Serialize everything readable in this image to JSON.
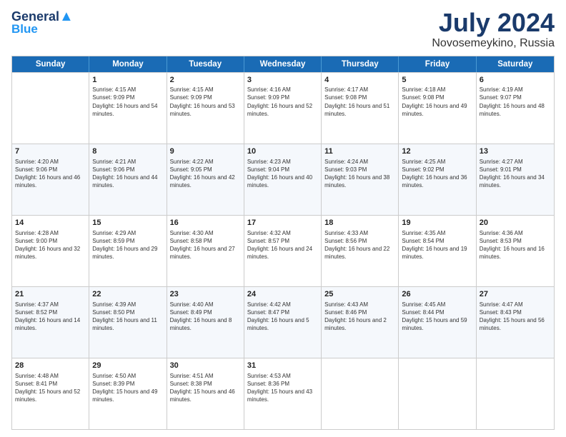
{
  "header": {
    "logo_line1": "General",
    "logo_line2": "Blue",
    "title": "July 2024",
    "subtitle": "Novosemeykino, Russia"
  },
  "days": [
    "Sunday",
    "Monday",
    "Tuesday",
    "Wednesday",
    "Thursday",
    "Friday",
    "Saturday"
  ],
  "weeks": [
    [
      {
        "day": "",
        "sunrise": "",
        "sunset": "",
        "daylight": ""
      },
      {
        "day": "1",
        "sunrise": "Sunrise: 4:15 AM",
        "sunset": "Sunset: 9:09 PM",
        "daylight": "Daylight: 16 hours and 54 minutes."
      },
      {
        "day": "2",
        "sunrise": "Sunrise: 4:15 AM",
        "sunset": "Sunset: 9:09 PM",
        "daylight": "Daylight: 16 hours and 53 minutes."
      },
      {
        "day": "3",
        "sunrise": "Sunrise: 4:16 AM",
        "sunset": "Sunset: 9:09 PM",
        "daylight": "Daylight: 16 hours and 52 minutes."
      },
      {
        "day": "4",
        "sunrise": "Sunrise: 4:17 AM",
        "sunset": "Sunset: 9:08 PM",
        "daylight": "Daylight: 16 hours and 51 minutes."
      },
      {
        "day": "5",
        "sunrise": "Sunrise: 4:18 AM",
        "sunset": "Sunset: 9:08 PM",
        "daylight": "Daylight: 16 hours and 49 minutes."
      },
      {
        "day": "6",
        "sunrise": "Sunrise: 4:19 AM",
        "sunset": "Sunset: 9:07 PM",
        "daylight": "Daylight: 16 hours and 48 minutes."
      }
    ],
    [
      {
        "day": "7",
        "sunrise": "Sunrise: 4:20 AM",
        "sunset": "Sunset: 9:06 PM",
        "daylight": "Daylight: 16 hours and 46 minutes."
      },
      {
        "day": "8",
        "sunrise": "Sunrise: 4:21 AM",
        "sunset": "Sunset: 9:06 PM",
        "daylight": "Daylight: 16 hours and 44 minutes."
      },
      {
        "day": "9",
        "sunrise": "Sunrise: 4:22 AM",
        "sunset": "Sunset: 9:05 PM",
        "daylight": "Daylight: 16 hours and 42 minutes."
      },
      {
        "day": "10",
        "sunrise": "Sunrise: 4:23 AM",
        "sunset": "Sunset: 9:04 PM",
        "daylight": "Daylight: 16 hours and 40 minutes."
      },
      {
        "day": "11",
        "sunrise": "Sunrise: 4:24 AM",
        "sunset": "Sunset: 9:03 PM",
        "daylight": "Daylight: 16 hours and 38 minutes."
      },
      {
        "day": "12",
        "sunrise": "Sunrise: 4:25 AM",
        "sunset": "Sunset: 9:02 PM",
        "daylight": "Daylight: 16 hours and 36 minutes."
      },
      {
        "day": "13",
        "sunrise": "Sunrise: 4:27 AM",
        "sunset": "Sunset: 9:01 PM",
        "daylight": "Daylight: 16 hours and 34 minutes."
      }
    ],
    [
      {
        "day": "14",
        "sunrise": "Sunrise: 4:28 AM",
        "sunset": "Sunset: 9:00 PM",
        "daylight": "Daylight: 16 hours and 32 minutes."
      },
      {
        "day": "15",
        "sunrise": "Sunrise: 4:29 AM",
        "sunset": "Sunset: 8:59 PM",
        "daylight": "Daylight: 16 hours and 29 minutes."
      },
      {
        "day": "16",
        "sunrise": "Sunrise: 4:30 AM",
        "sunset": "Sunset: 8:58 PM",
        "daylight": "Daylight: 16 hours and 27 minutes."
      },
      {
        "day": "17",
        "sunrise": "Sunrise: 4:32 AM",
        "sunset": "Sunset: 8:57 PM",
        "daylight": "Daylight: 16 hours and 24 minutes."
      },
      {
        "day": "18",
        "sunrise": "Sunrise: 4:33 AM",
        "sunset": "Sunset: 8:56 PM",
        "daylight": "Daylight: 16 hours and 22 minutes."
      },
      {
        "day": "19",
        "sunrise": "Sunrise: 4:35 AM",
        "sunset": "Sunset: 8:54 PM",
        "daylight": "Daylight: 16 hours and 19 minutes."
      },
      {
        "day": "20",
        "sunrise": "Sunrise: 4:36 AM",
        "sunset": "Sunset: 8:53 PM",
        "daylight": "Daylight: 16 hours and 16 minutes."
      }
    ],
    [
      {
        "day": "21",
        "sunrise": "Sunrise: 4:37 AM",
        "sunset": "Sunset: 8:52 PM",
        "daylight": "Daylight: 16 hours and 14 minutes."
      },
      {
        "day": "22",
        "sunrise": "Sunrise: 4:39 AM",
        "sunset": "Sunset: 8:50 PM",
        "daylight": "Daylight: 16 hours and 11 minutes."
      },
      {
        "day": "23",
        "sunrise": "Sunrise: 4:40 AM",
        "sunset": "Sunset: 8:49 PM",
        "daylight": "Daylight: 16 hours and 8 minutes."
      },
      {
        "day": "24",
        "sunrise": "Sunrise: 4:42 AM",
        "sunset": "Sunset: 8:47 PM",
        "daylight": "Daylight: 16 hours and 5 minutes."
      },
      {
        "day": "25",
        "sunrise": "Sunrise: 4:43 AM",
        "sunset": "Sunset: 8:46 PM",
        "daylight": "Daylight: 16 hours and 2 minutes."
      },
      {
        "day": "26",
        "sunrise": "Sunrise: 4:45 AM",
        "sunset": "Sunset: 8:44 PM",
        "daylight": "Daylight: 15 hours and 59 minutes."
      },
      {
        "day": "27",
        "sunrise": "Sunrise: 4:47 AM",
        "sunset": "Sunset: 8:43 PM",
        "daylight": "Daylight: 15 hours and 56 minutes."
      }
    ],
    [
      {
        "day": "28",
        "sunrise": "Sunrise: 4:48 AM",
        "sunset": "Sunset: 8:41 PM",
        "daylight": "Daylight: 15 hours and 52 minutes."
      },
      {
        "day": "29",
        "sunrise": "Sunrise: 4:50 AM",
        "sunset": "Sunset: 8:39 PM",
        "daylight": "Daylight: 15 hours and 49 minutes."
      },
      {
        "day": "30",
        "sunrise": "Sunrise: 4:51 AM",
        "sunset": "Sunset: 8:38 PM",
        "daylight": "Daylight: 15 hours and 46 minutes."
      },
      {
        "day": "31",
        "sunrise": "Sunrise: 4:53 AM",
        "sunset": "Sunset: 8:36 PM",
        "daylight": "Daylight: 15 hours and 43 minutes."
      },
      {
        "day": "",
        "sunrise": "",
        "sunset": "",
        "daylight": ""
      },
      {
        "day": "",
        "sunrise": "",
        "sunset": "",
        "daylight": ""
      },
      {
        "day": "",
        "sunrise": "",
        "sunset": "",
        "daylight": ""
      }
    ]
  ]
}
